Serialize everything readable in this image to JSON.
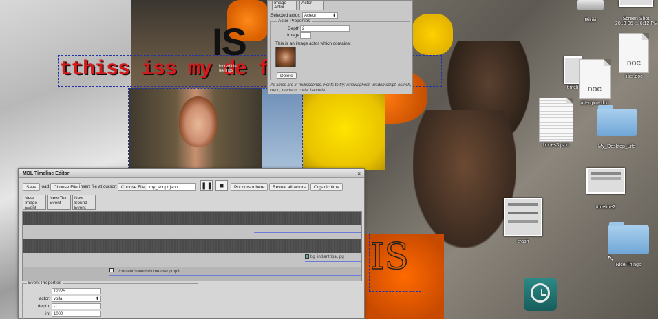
{
  "overlays": {
    "big_is": "IS",
    "title_text": "tthiss iss my de        fe",
    "ghost_is": "IS",
    "tiny_caption": "incredible feelings"
  },
  "actor_panel": {
    "tabs": [
      "Image Actor",
      "Actor"
    ],
    "selected_actor_label": "Selected actor:",
    "selected_actor_value": "Acteur",
    "properties_legend": "Actor Properties",
    "depth_label": "Depth",
    "depth_value": "2",
    "image_label": "Image",
    "image_value": "",
    "contains_text": "This is an image actor which contains:",
    "delete_label": "Delete",
    "note": "All times are in milliseconds. Fonts to try: iknowaghost, wisdomscript, ostrich, neou, mensch, code, barcode"
  },
  "editor": {
    "title": "MDL Timeline Editor",
    "close": "×",
    "save": "Save",
    "load_label": "load:",
    "load_button": "Choose File",
    "insert_label": "insert file at cursor:",
    "insert_button": "Choose File",
    "script_field": "my_script.json",
    "pause_icon": "❚❚",
    "stop_icon": "■",
    "put_cursor": "Put cursor here",
    "reveal": "Reveal all actors",
    "organic": "Organic time",
    "new_image": "New Image Event",
    "new_text": "New Text Event",
    "new_sound": "New Sound Event",
    "clip_image": "bg_indiantribal.jpg",
    "clip_sound": "../content/sounds/home-crazy.mp3",
    "event_legend": "Event Properties",
    "ev_time": "12225",
    "actor_label": "actor:",
    "actor_value": "voila",
    "depth_label": "depth:",
    "depth_value": "-1",
    "in_label": "in:",
    "in_value": "1000"
  },
  "desktop": {
    "rikiki": "Rikiki",
    "screenshot": "Screen Shot",
    "screenshot_date": "2013-06-... 6:12 PM",
    "doc1_tag": "DOC",
    "doc1": "lists.doc",
    "doc2_tag": "DOC",
    "doc2": "afterglow.doc",
    "timeline_partial": "timeli",
    "bones": "bones3.json",
    "desktop_life": "My_Desktop_Life",
    "timeline2": "timeline2",
    "crash": "crash",
    "nice_things": "Nice Things"
  }
}
